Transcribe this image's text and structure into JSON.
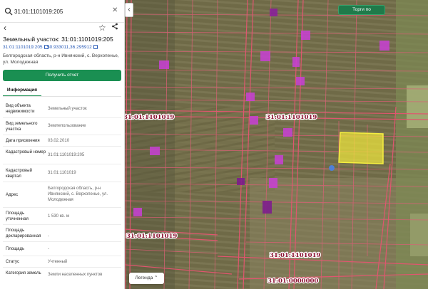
{
  "search": {
    "value": "31:01:1101019:205",
    "clear_label": "✕"
  },
  "header": {
    "title": "Земельный участок: 31:01:1101019:205",
    "chip_number": "31:01:1101019:205",
    "chip_coords": "50.933011,36.295912",
    "address": "Белгородская область, р-н Ивнянский, с. Верхопенье, ул. Молодежная"
  },
  "actions": {
    "report_label": "Получить отчет"
  },
  "tabs": [
    {
      "label": "Информация",
      "active": true
    }
  ],
  "info_rows": [
    {
      "key": "Вид объекта недвижимости",
      "value": "Земельный участок"
    },
    {
      "key": "Вид земельного участка",
      "value": "Землепользование"
    },
    {
      "key": "Дата присвоения",
      "value": "03.02.2010"
    },
    {
      "key": "Кадастровый номер",
      "value": "31:01:1101019:205"
    },
    {
      "key": "Кадастровый квартал",
      "value": "31:01:1101019"
    },
    {
      "key": "Адрес",
      "value": "Белгородская область, р-н Ивнянский, с. Верхопенье, ул. Молодежная"
    },
    {
      "key": "Площадь уточненная",
      "value": "1 530 кв. м"
    },
    {
      "key": "Площадь декларированная",
      "value": "-"
    },
    {
      "key": "Площадь",
      "value": "-"
    },
    {
      "key": "Статус",
      "value": "Учтенный"
    },
    {
      "key": "Категория земель",
      "value": "Земли населенных пунктов"
    }
  ],
  "map": {
    "quarter_labels": [
      "31:01:1101019",
      "31:01:1101019",
      "31:01:1101019",
      "31:01:1101019",
      "31:01:0000000"
    ],
    "legend_label": "Легенда ⌃",
    "auction_label": "Торги по",
    "collapse_label": "‹",
    "colors": {
      "parcel_line": "#e0566f",
      "selected": "#f2ea3c",
      "marker": "#c93fd6",
      "field": "#6e6a45"
    }
  }
}
